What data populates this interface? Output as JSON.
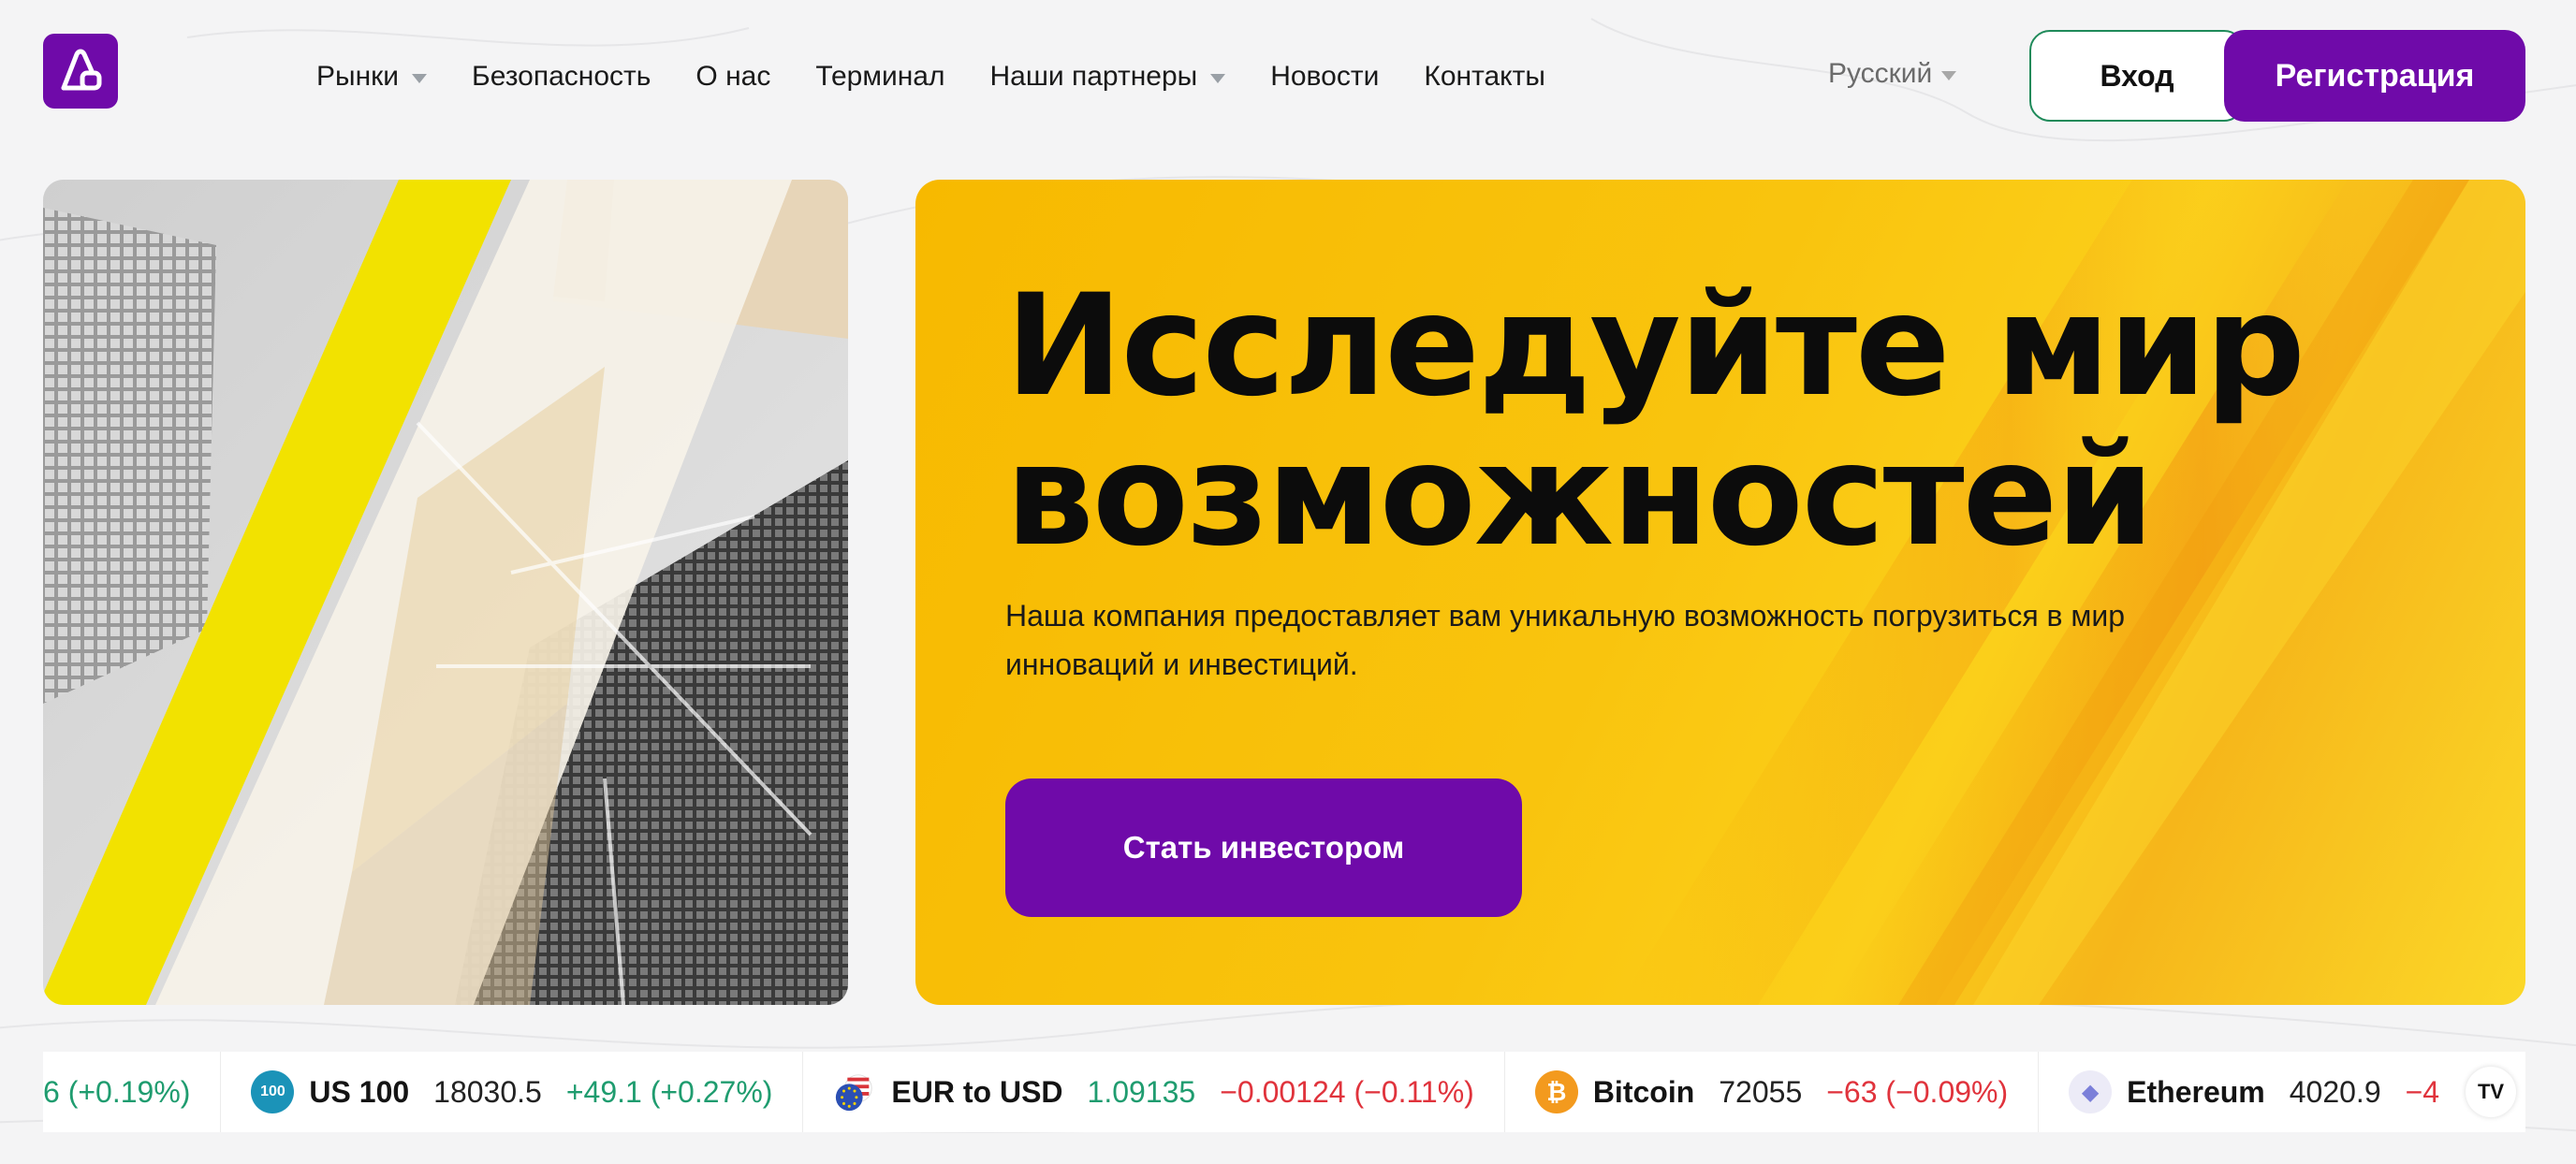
{
  "header": {
    "nav": [
      {
        "label": "Рынки",
        "dropdown": true
      },
      {
        "label": "Безопасность",
        "dropdown": false
      },
      {
        "label": "О нас",
        "dropdown": false
      },
      {
        "label": "Терминал",
        "dropdown": false
      },
      {
        "label": "Наши партнеры",
        "dropdown": true
      },
      {
        "label": "Новости",
        "dropdown": false
      },
      {
        "label": "Контакты",
        "dropdown": false
      }
    ],
    "language": "Русский",
    "login_label": "Вход",
    "register_label": "Регистрация"
  },
  "hero": {
    "title_line1": "Исследуйте мир",
    "title_line2": "возможностей",
    "text_line1": "Наша компания предоставляет вам уникальную возможность погрузиться в мир",
    "text_line2": "инноваций и инвестиций.",
    "cta_label": "Стать инвестором"
  },
  "ticker": {
    "partial_first_change": "6 (+0.19%)",
    "items": [
      {
        "icon": "us100-icon",
        "icon_text": "100",
        "name": "US 100",
        "price": "18030.5",
        "change": "+49.1 (+0.27%)",
        "direction": "up",
        "color": "#1b93b8"
      },
      {
        "icon": "eur-usd-flag-icon",
        "icon_text": "",
        "name": "EUR to USD",
        "price": "1.09135",
        "change": "−0.00124 (−0.11%)",
        "direction": "down",
        "color": "#2b4fb3"
      },
      {
        "icon": "bitcoin-icon",
        "icon_text": "₿",
        "name": "Bitcoin",
        "price": "72055",
        "change": "−63 (−0.09%)",
        "direction": "down",
        "color": "#f39a1e"
      },
      {
        "icon": "ethereum-icon",
        "icon_text": "◆",
        "name": "Ethereum",
        "price": "4020.9",
        "change": "−4",
        "direction": "down",
        "color": "#e8e6f5"
      }
    ],
    "badge": "TV"
  },
  "colors": {
    "brand_purple": "#6f0aa9",
    "hero_yellow": "#f9c40e",
    "up_green": "#1f9c6f",
    "down_red": "#e0333c",
    "login_border": "#1f8a5a"
  }
}
